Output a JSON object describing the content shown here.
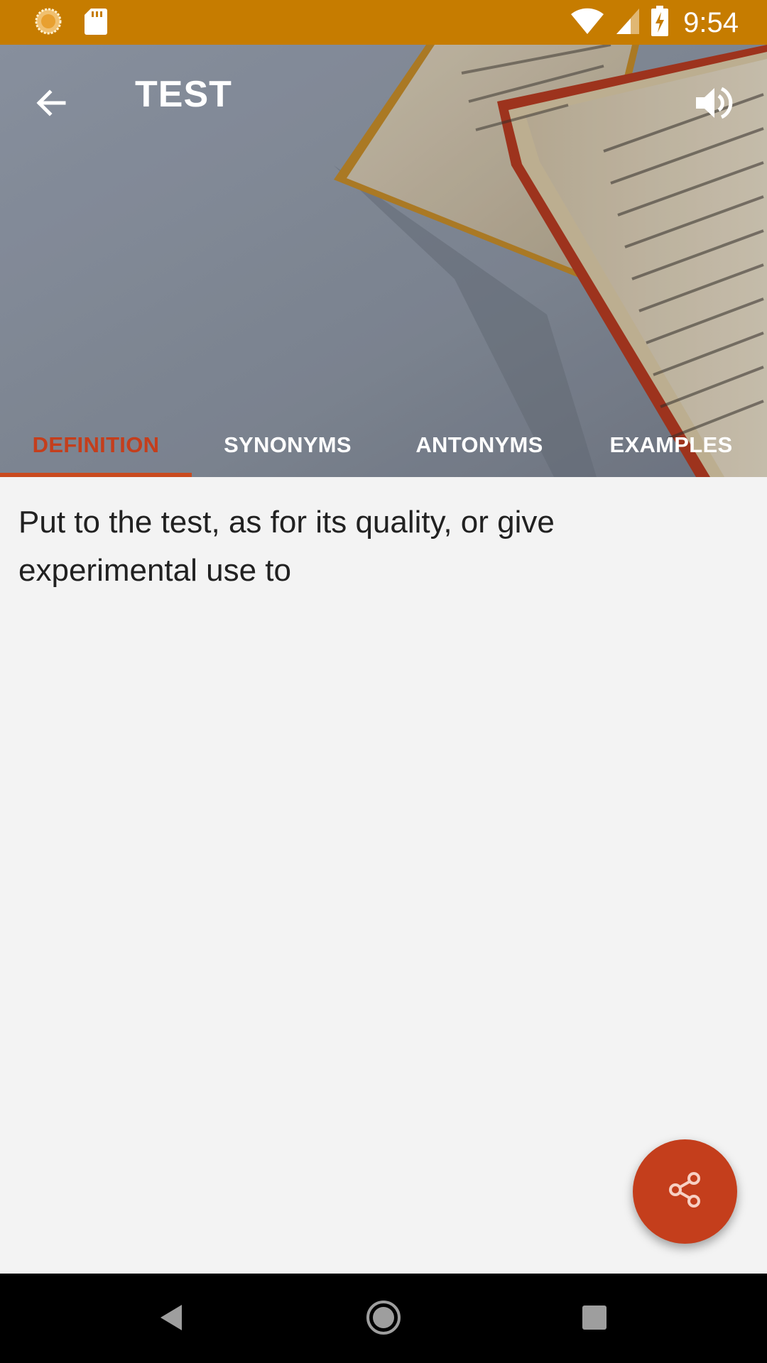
{
  "status_bar": {
    "time": "9:54",
    "left_icons": [
      "notification-circle-icon",
      "sd-card-icon"
    ],
    "right_icons": [
      "wifi-icon",
      "cell-signal-icon",
      "battery-charging-icon"
    ]
  },
  "toolbar": {
    "title": "TEST",
    "back_icon": "arrow-back-icon",
    "speaker_icon": "volume-icon"
  },
  "tabs": [
    {
      "label": "DEFINITION",
      "active": true
    },
    {
      "label": "SYNONYMS",
      "active": false
    },
    {
      "label": "ANTONYMS",
      "active": false
    },
    {
      "label": "EXAMPLES",
      "active": false
    }
  ],
  "definition": {
    "text": "Put to the test, as for its quality, or give experimental use to"
  },
  "fab": {
    "icon": "share-icon"
  },
  "nav_bar": {
    "icons": [
      "nav-back-icon",
      "nav-home-icon",
      "nav-recents-icon"
    ]
  },
  "colors": {
    "status_bar": "#c67c00",
    "accent": "#c43e1c",
    "indicator": "#c94a1e",
    "content_bg": "#f3f3f3",
    "text": "#212121"
  }
}
